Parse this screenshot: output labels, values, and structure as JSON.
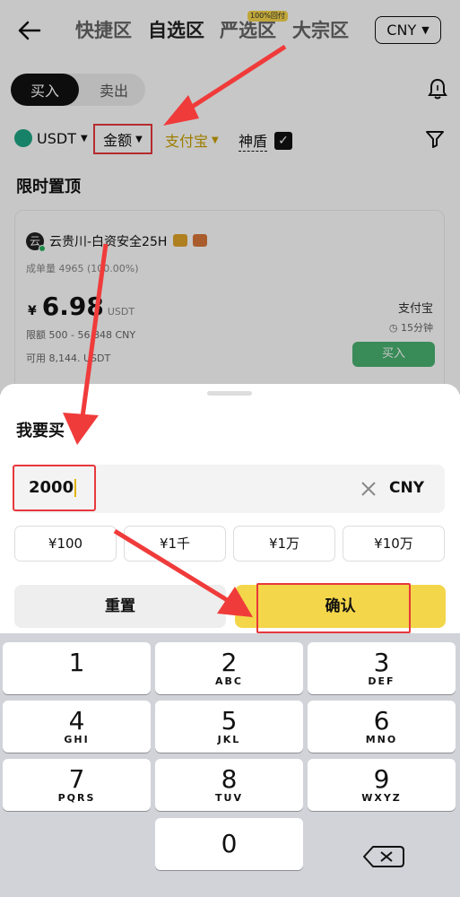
{
  "topnav": {
    "tabs": [
      "快捷区",
      "自选区",
      "严选区",
      "大宗区"
    ],
    "active_tab": "自选区",
    "badge": "100%回付",
    "currency": "CNY"
  },
  "trade_toggle": {
    "buy": "买入",
    "sell": "卖出"
  },
  "filters": {
    "coin": "USDT",
    "amount": "金额",
    "payment": "支付宝",
    "shield": "神盾"
  },
  "section_title": "限时置顶",
  "card": {
    "avatar_char": "云",
    "merchant": "云贵川-白资安全25H",
    "orders": "成单量 4965 (100.00%)",
    "currency_symbol": "¥",
    "price": "6.98",
    "price_unit": "USDT",
    "limit": "限额  500 - 56,848 CNY",
    "available": "可用  8,144.  USDT",
    "payment": "支付宝",
    "time": "15分钟",
    "buy_label": "买入"
  },
  "sheet": {
    "title": "我要买",
    "amount_value": "2000",
    "amount_currency": "CNY",
    "quick_amounts": [
      "¥100",
      "¥1千",
      "¥1万",
      "¥10万"
    ],
    "reset_label": "重置",
    "confirm_label": "确认"
  },
  "keyboard": {
    "keys": [
      {
        "num": "1",
        "letters": ""
      },
      {
        "num": "2",
        "letters": "ABC"
      },
      {
        "num": "3",
        "letters": "DEF"
      },
      {
        "num": "4",
        "letters": "GHI"
      },
      {
        "num": "5",
        "letters": "JKL"
      },
      {
        "num": "6",
        "letters": "MNO"
      },
      {
        "num": "7",
        "letters": "PQRS"
      },
      {
        "num": "8",
        "letters": "TUV"
      },
      {
        "num": "9",
        "letters": "WXYZ"
      },
      {
        "num": "0",
        "letters": ""
      }
    ]
  },
  "colors": {
    "accent_yellow": "#f3d64a",
    "highlight_red": "#e8383d",
    "buy_green": "#49b271"
  }
}
